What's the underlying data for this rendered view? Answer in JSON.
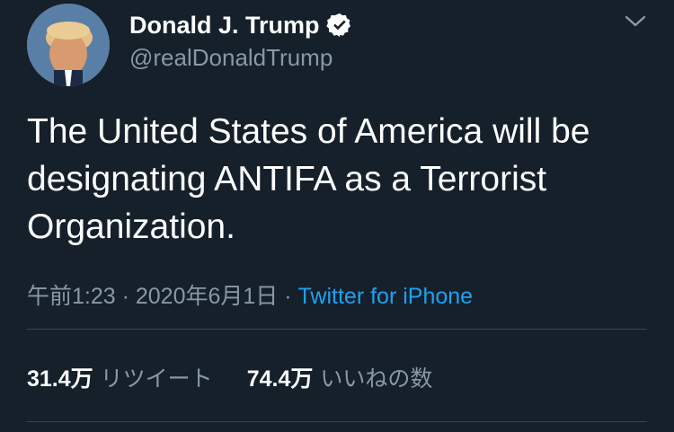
{
  "author": {
    "display_name": "Donald J. Trump",
    "handle": "@realDonaldTrump"
  },
  "tweet": {
    "text": "The United States of America will be designating ANTIFA as a Terrorist Organization."
  },
  "meta": {
    "timestamp": "午前1:23 · 2020年6月1日",
    "separator": " · ",
    "source": "Twitter for iPhone"
  },
  "stats": {
    "retweets_count": "31.4万",
    "retweets_label": "リツイート",
    "likes_count": "74.4万",
    "likes_label": "いいねの数"
  },
  "icons": {
    "verified": "verified-badge-icon",
    "menu": "chevron-down-icon"
  },
  "colors": {
    "background": "#15202b",
    "secondary_text": "#8899a6",
    "link": "#1da1f2",
    "divider": "#38444d"
  }
}
